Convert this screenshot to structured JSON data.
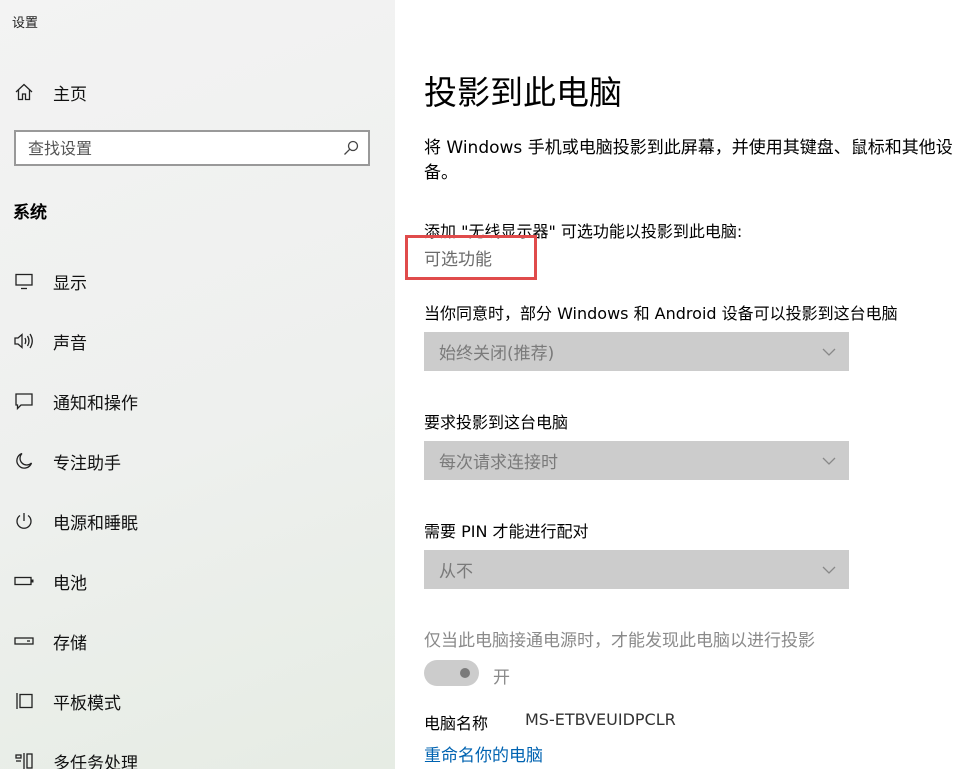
{
  "window": {
    "title": "设置"
  },
  "sidebar": {
    "home_label": "主页",
    "search_placeholder": "查找设置",
    "section_title": "系统",
    "items": [
      {
        "label": "显示",
        "icon": "monitor-icon"
      },
      {
        "label": "声音",
        "icon": "speaker-icon"
      },
      {
        "label": "通知和操作",
        "icon": "notification-icon"
      },
      {
        "label": "专注助手",
        "icon": "moon-icon"
      },
      {
        "label": "电源和睡眠",
        "icon": "power-icon"
      },
      {
        "label": "电池",
        "icon": "battery-icon"
      },
      {
        "label": "存储",
        "icon": "storage-icon"
      },
      {
        "label": "平板模式",
        "icon": "tablet-mode-icon"
      },
      {
        "label": "多任务处理",
        "icon": "multitasking-icon"
      }
    ]
  },
  "main": {
    "title": "投影到此电脑",
    "description": "将 Windows 手机或电脑投影到此屏幕，并使用其键盘、鼠标和其他设备。",
    "add_feature_label": "添加 \"无线显示器\" 可选功能以投影到此电脑:",
    "optional_features_link": "可选功能",
    "allow_label": "当你同意时，部分 Windows 和 Android 设备可以投影到这台电脑",
    "allow_value": "始终关闭(推荐)",
    "ask_label": "要求投影到这台电脑",
    "ask_value": "每次请求连接时",
    "pin_label": "需要 PIN 才能进行配对",
    "pin_value": "从不",
    "power_hint": "仅当此电脑接通电源时，才能发现此电脑以进行投影",
    "toggle_state": "开",
    "pc_name_label": "电脑名称",
    "pc_name_value": "MS-ETBVEUIDPCLR",
    "rename_link": "重命名你的电脑"
  },
  "colors": {
    "link": "#0063b1",
    "highlight_border": "#e04b4b",
    "disabled_control": "#cccccc"
  }
}
